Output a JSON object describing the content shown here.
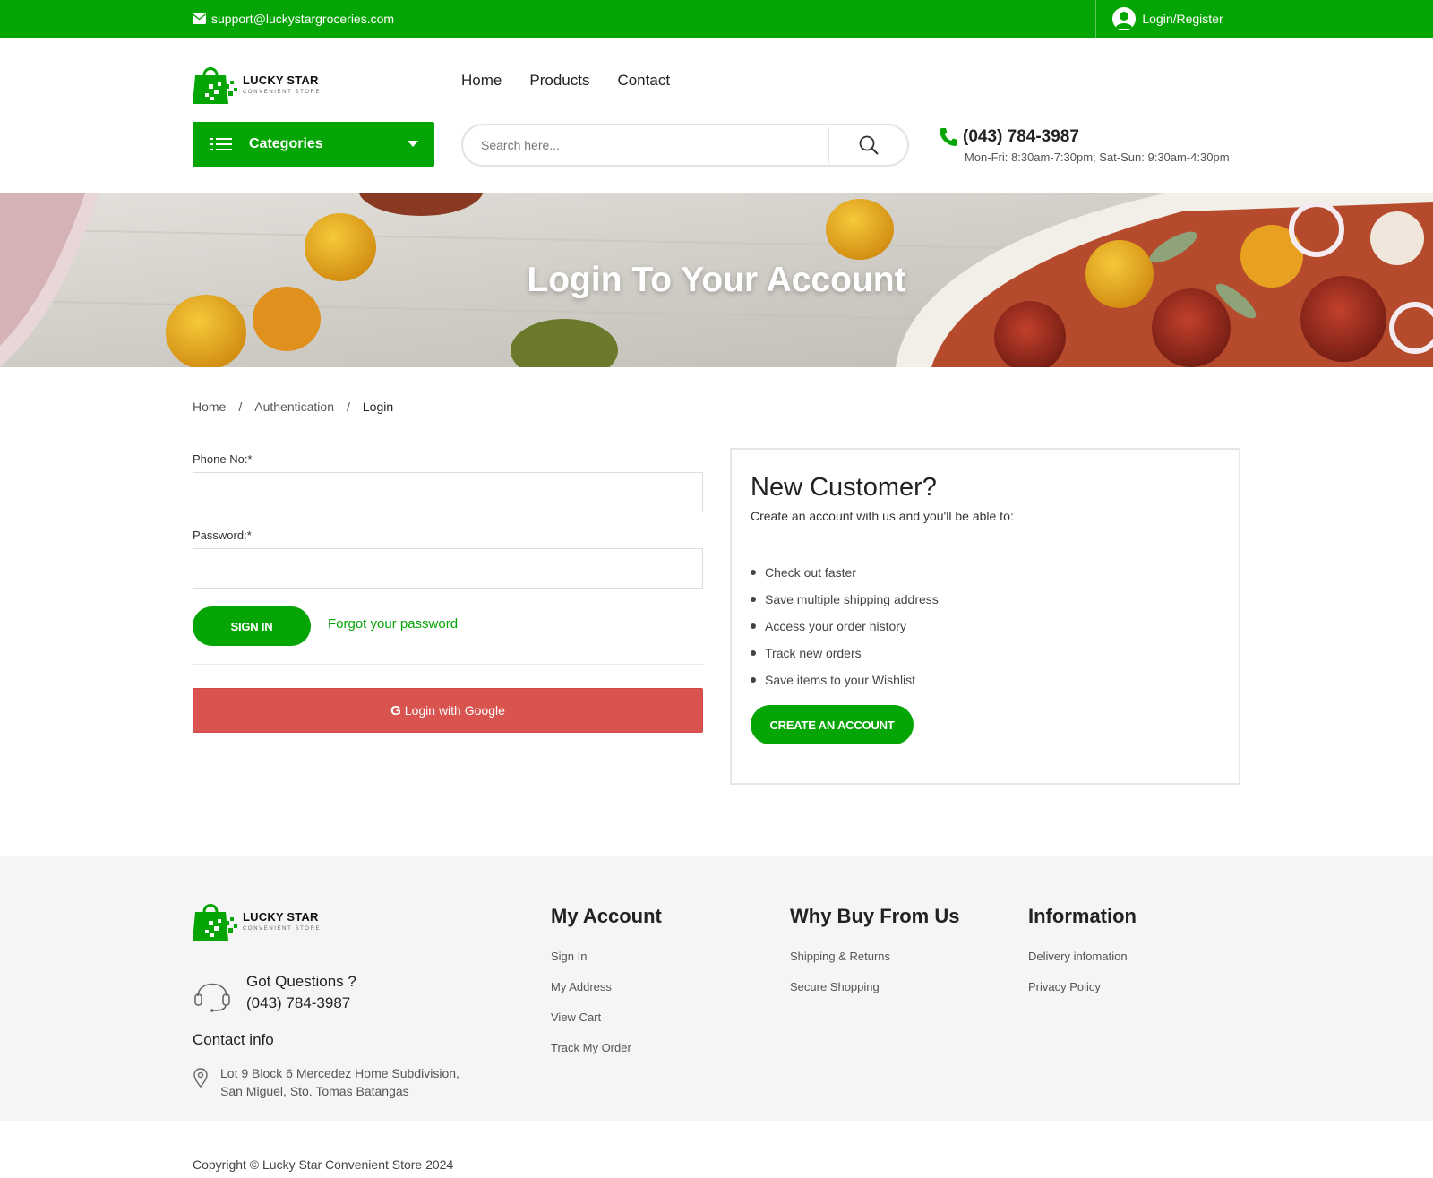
{
  "topbar": {
    "email": "support@luckystargroceries.com",
    "login_label": "Login/Register"
  },
  "brand": {
    "name": "LUCKY STAR",
    "tagline": "CONVENIENT STORE"
  },
  "nav": {
    "items": [
      "Home",
      "Products",
      "Contact"
    ]
  },
  "categories": {
    "label": "Categories"
  },
  "search": {
    "placeholder": "Search here..."
  },
  "contact": {
    "phone": "(043) 784-3987",
    "hours": "Mon-Fri: 8:30am-7:30pm; Sat-Sun: 9:30am-4:30pm"
  },
  "banner": {
    "title": "Login To Your Account"
  },
  "breadcrumb": {
    "items": [
      "Home",
      "Authentication",
      "Login"
    ],
    "separator": "/"
  },
  "login_form": {
    "phone_label": "Phone No:*",
    "phone_value": "",
    "password_label": "Password:*",
    "password_value": "",
    "signin_label": "SIGN IN",
    "forgot_label": "Forgot your password",
    "google_icon": "G",
    "google_label": "Login with Google"
  },
  "new_customer": {
    "title": "New Customer?",
    "intro": "Create an account with us and you'll be able to:",
    "benefits": [
      "Check out faster",
      "Save multiple shipping address",
      "Access your order history",
      "Track new orders",
      "Save items to your Wishlist"
    ],
    "create_label": "CREATE AN ACCOUNT"
  },
  "footer": {
    "questions_title": "Got Questions ?",
    "questions_phone": "(043) 784-3987",
    "contact_info_title": "Contact info",
    "address_line1": "Lot 9 Block 6 Mercedez Home Subdivision,",
    "address_line2": "San Miguel, Sto. Tomas Batangas",
    "columns": [
      {
        "title": "My Account",
        "links": [
          "Sign In",
          "My Address",
          "View Cart",
          "Track My Order"
        ]
      },
      {
        "title": "Why Buy From Us",
        "links": [
          "Shipping & Returns",
          "Secure Shopping"
        ]
      },
      {
        "title": "Information",
        "links": [
          "Delivery infomation",
          "Privacy Policy"
        ]
      }
    ]
  },
  "copyright": "Copyright © Lucky Star Convenient Store 2024",
  "colors": {
    "brand_green": "#06a506",
    "google_red": "#d9534f"
  },
  "icons": {
    "email": "envelope-icon",
    "login": "user-icon",
    "categories": "list-icon",
    "dropdown": "caret-down-icon",
    "search": "search-icon",
    "phone": "phone-icon",
    "support": "headset-icon",
    "address": "map-pin-icon"
  }
}
